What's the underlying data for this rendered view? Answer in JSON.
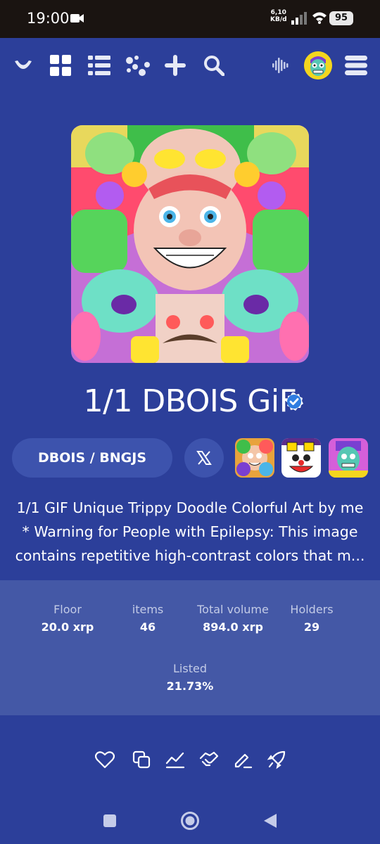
{
  "status_bar": {
    "time": "19:00",
    "net_speed_value": "6,10",
    "net_speed_unit": "KB/d",
    "battery": "95"
  },
  "nav": {
    "icons": [
      "logo-icon",
      "grid-icon",
      "list-icon",
      "scatter-icon",
      "plus-icon",
      "search-icon",
      "audio-icon",
      "avatar",
      "menu-icon"
    ]
  },
  "collection": {
    "title": "1/1 DBOIS GiF",
    "creator": "DBOIS / BNGJS",
    "description_line1": "1/1 GIF Unique Trippy Doodle Colorful Art by me",
    "description_line2": "* Warning for People with Epilepsy: This image",
    "description_line3": "contains repetitive high-contrast colors that m..."
  },
  "stats": {
    "floor_label": "Floor",
    "floor_value": "20.0 xrp",
    "items_label": "items",
    "items_value": "46",
    "volume_label": "Total volume",
    "volume_value": "894.0 xrp",
    "holders_label": "Holders",
    "holders_value": "29",
    "listed_label": "Listed",
    "listed_value": "21.73%"
  },
  "colors": {
    "background": "#2c3f9a",
    "statusbar": "#1a1411",
    "stats_panel": "#4458a6",
    "pill": "#3d53ad",
    "verified": "#2f7de1",
    "avatar_bg": "#f3d61e"
  }
}
